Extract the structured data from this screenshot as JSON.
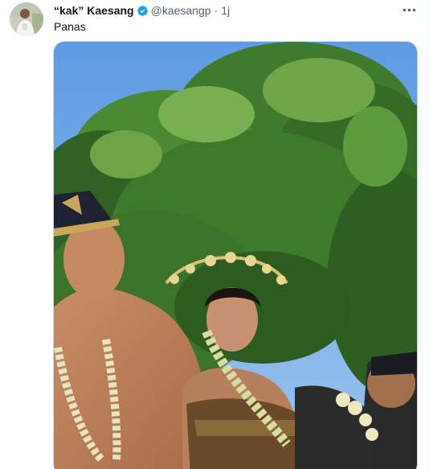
{
  "tweet": {
    "display_name": "“kak” Kaesang",
    "handle": "@kaesangp",
    "separator": "·",
    "time": "1j",
    "text": "Panas",
    "verified_icon": "verified-badge-icon",
    "more_icon": "more-options-icon",
    "media_description": "photo-bride-groom-javanese-wedding"
  },
  "colors": {
    "verified_blue": "#1d9bf0",
    "secondary_text": "#536471",
    "primary_text": "#0f1419",
    "border": "#cfd9de"
  }
}
